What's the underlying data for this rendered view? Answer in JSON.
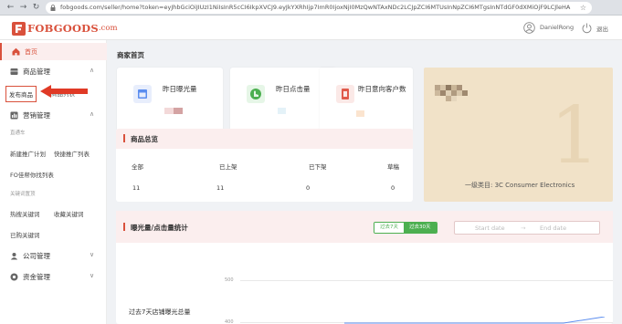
{
  "browser": {
    "url": "fobgoods.com/seller/home?token=eyJhbGciOiJIUzI1NiIsInR5cCI6IkpXVCJ9.eyJkYXRhIjp7ImR0IjoxNjI0MzQwNTAxNDc2LCJpZCI6MTUsInNpZCI6MTgsInNTdGF0dXMiOjF9LCJleHA"
  },
  "header": {
    "logo_brand": "FOBGOODS",
    "logo_domain": ".com",
    "user_name": "DanielRong",
    "logout_label": "退出"
  },
  "sidebar": {
    "home": "首页",
    "product_mgmt": "商品管理",
    "publish_product": "发布商品",
    "product_list": "商品列表",
    "marketing_mgmt": "营销管理",
    "section_direct": "直通车",
    "new_campaign": "新建推广计划",
    "quick_campaign_list": "快捷推广列表",
    "fo_list": "FO佳帮你找列表",
    "section_keywords": "关键词置顶",
    "hot_keywords": "热搜关键词",
    "saved_keywords": "收藏关键词",
    "bought_keywords": "已购关键词",
    "company_mgmt": "公司管理",
    "fund_mgmt": "资金管理"
  },
  "main": {
    "page_title": "商家首页",
    "cards": [
      {
        "label": "昨日曝光量",
        "accent": "#5b8def"
      },
      {
        "label": "昨日点击量",
        "accent": "#4caf50"
      },
      {
        "label": "昨日意向客户数",
        "accent": "#e05a4b"
      }
    ],
    "banner_category": "一级类目: 3C Consumer Electronics",
    "overview": {
      "title": "商品总览",
      "columns": [
        {
          "label": "全部",
          "value": "11"
        },
        {
          "label": "已上架",
          "value": "11"
        },
        {
          "label": "已下架",
          "value": "0"
        },
        {
          "label": "草稿",
          "value": "0"
        }
      ]
    },
    "stats": {
      "title": "曝光量/点击量统计",
      "toggle_7": "过去7天",
      "toggle_30": "过去30天",
      "start_placeholder": "Start date",
      "end_placeholder": "End date",
      "range_sep": "→",
      "subtitle": "过去7天店铺曝光总量",
      "tick_500": "500",
      "tick_400": "400"
    }
  },
  "colors": {
    "brand": "#d9513c",
    "green": "#4caf50"
  }
}
